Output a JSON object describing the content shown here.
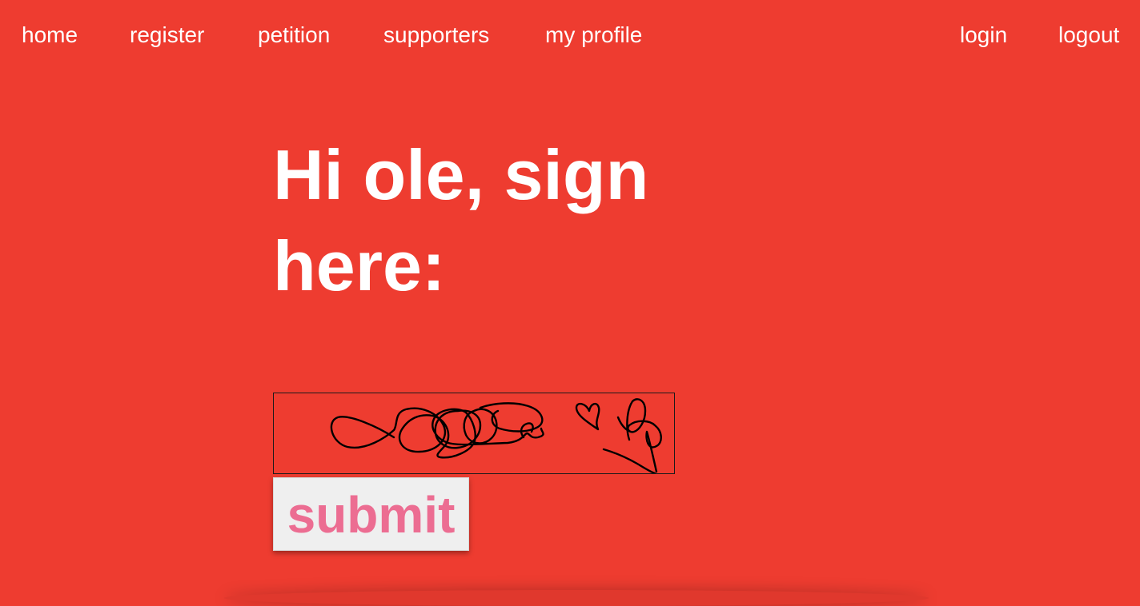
{
  "colors": {
    "background": "#ee3c30",
    "text": "#ffffff",
    "submit_text": "#ec6d92",
    "submit_background": "#efefef"
  },
  "nav": {
    "left": [
      {
        "label": "home"
      },
      {
        "label": "register"
      },
      {
        "label": "petition"
      },
      {
        "label": "supporters"
      },
      {
        "label": "my profile"
      }
    ],
    "right": [
      {
        "label": "login"
      },
      {
        "label": "logout"
      }
    ]
  },
  "main": {
    "heading": "Hi ole, sign here:",
    "submit_label": "submit"
  }
}
